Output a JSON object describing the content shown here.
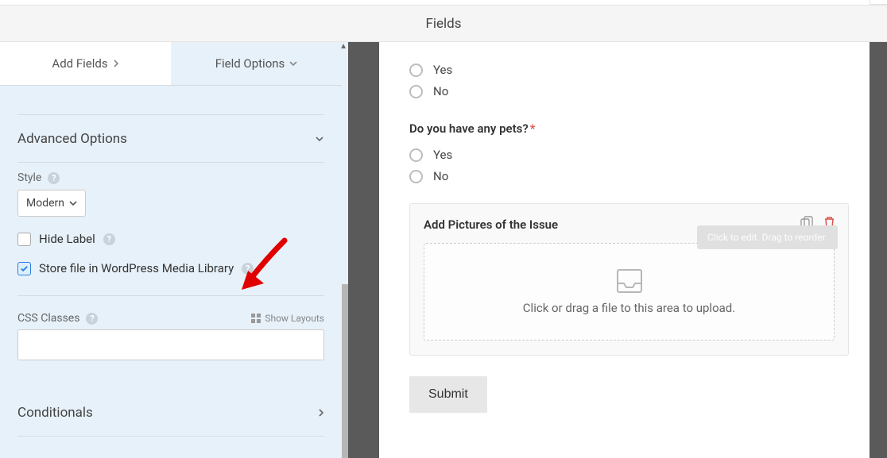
{
  "header": {
    "title": "Fields"
  },
  "tabs": {
    "add": "Add Fields",
    "options": "Field Options"
  },
  "sections": {
    "advanced": "Advanced Options",
    "conditionals": "Conditionals"
  },
  "style": {
    "label": "Style",
    "value": "Modern"
  },
  "checks": {
    "hide_label": "Hide Label",
    "store_media": "Store file in WordPress Media Library"
  },
  "css": {
    "label": "CSS Classes",
    "show_layouts": "Show Layouts"
  },
  "preview": {
    "opt_yes": "Yes",
    "opt_no": "No",
    "q_pets": "Do you have any pets?",
    "upload_title": "Add Pictures of the Issue",
    "upload_hint": "Click or drag a file to this area to upload.",
    "tooltip": "Click to edit. Drag to reorder.",
    "submit": "Submit"
  }
}
